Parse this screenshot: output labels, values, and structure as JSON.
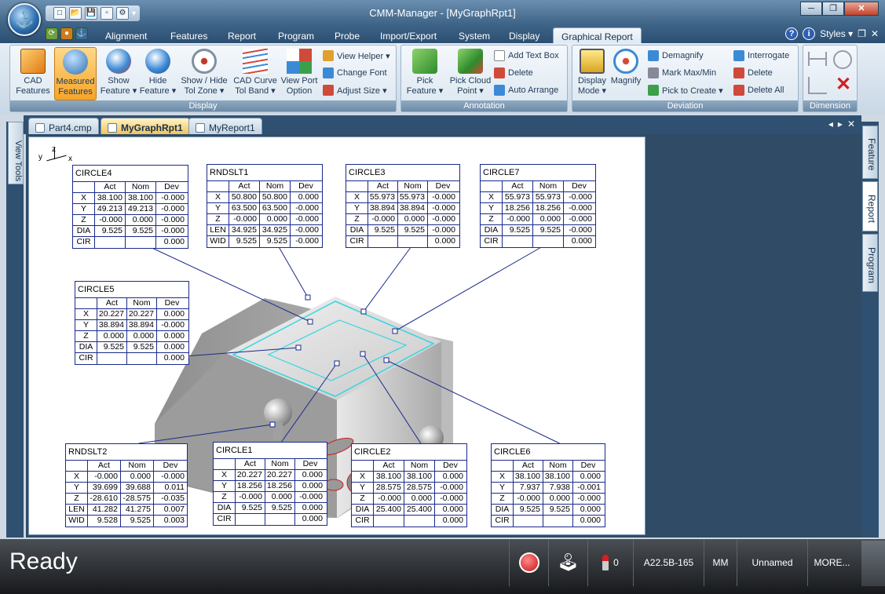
{
  "window": {
    "title": "CMM-Manager - [MyGraphRpt1]",
    "min": "─",
    "max": "❐",
    "close": "✕"
  },
  "quick_access": [
    "□",
    "📂",
    "💾",
    "▫",
    "⚙",
    "▾"
  ],
  "mini_tools": [
    "⟳",
    "●",
    "⚓"
  ],
  "ribbon_tabs": [
    "Alignment",
    "Features",
    "Report",
    "Program",
    "Probe",
    "Import/Export",
    "System",
    "Display",
    "Graphical Report"
  ],
  "active_tab": "Graphical Report",
  "right_options": {
    "help": "?",
    "info": "i",
    "styles": "Styles ▾",
    "restore": "❐",
    "close": "✕"
  },
  "ribbon": {
    "display": {
      "label": "Display",
      "cad": "CAD Features",
      "measured": "Measured Features",
      "show": "Show Feature ▾",
      "hide": "Hide Feature ▾",
      "tolzone": "Show / Hide Tol Zone ▾",
      "curve": "CAD Curve Tol Band ▾",
      "viewport": "View Port Option",
      "viewhelper": "View Helper ▾",
      "changefont": "Change Font",
      "adjustsize": "Adjust Size ▾"
    },
    "annotation": {
      "label": "Annotation",
      "pick": "Pick Feature ▾",
      "cloud": "Pick Cloud Point ▾",
      "addtext": "Add Text Box",
      "delete": "Delete",
      "autoarrange": "Auto Arrange"
    },
    "deviation": {
      "label": "Deviation",
      "mode": "Display Mode ▾",
      "magnify": "Magnify",
      "demagnify": "Demagnify",
      "markmax": "Mark Max/Min",
      "picktocreate": "Pick to Create ▾",
      "interrogate": "Interrogate",
      "delete": "Delete",
      "deleteall": "Delete All"
    },
    "dimension": {
      "label": "Dimension"
    }
  },
  "doc_tabs": [
    "Part4.cmp",
    "MyGraphRpt1",
    "MyReport1"
  ],
  "active_doc": "MyGraphRpt1",
  "doc_controls": {
    "prev": "◂",
    "next": "▸",
    "close": "✕"
  },
  "left_panel": "View Tools",
  "right_panels": [
    "Feature",
    "Report",
    "Program"
  ],
  "axis": {
    "y": "y",
    "z": "z",
    "x": "x"
  },
  "tables": [
    {
      "name": "CIRCLE4",
      "rows": [
        [
          "X",
          "38.100",
          "38.100",
          "-0.000"
        ],
        [
          "Y",
          "49.213",
          "49.213",
          "-0.000"
        ],
        [
          "Z",
          "-0.000",
          "0.000",
          "-0.000"
        ],
        [
          "DIA",
          "9.525",
          "9.525",
          "-0.000"
        ],
        [
          "CIR",
          "",
          "",
          "0.000"
        ]
      ]
    },
    {
      "name": "RNDSLT1",
      "rows": [
        [
          "X",
          "50.800",
          "50.800",
          "0.000"
        ],
        [
          "Y",
          "63.500",
          "63.500",
          "-0.000"
        ],
        [
          "Z",
          "-0.000",
          "0.000",
          "-0.000"
        ],
        [
          "LEN",
          "34.925",
          "34.925",
          "-0.000"
        ],
        [
          "WID",
          "9.525",
          "9.525",
          "-0.000"
        ]
      ]
    },
    {
      "name": "CIRCLE3",
      "rows": [
        [
          "X",
          "55.973",
          "55.973",
          "-0.000"
        ],
        [
          "Y",
          "38.894",
          "38.894",
          "-0.000"
        ],
        [
          "Z",
          "-0.000",
          "0.000",
          "-0.000"
        ],
        [
          "DIA",
          "9.525",
          "9.525",
          "-0.000"
        ],
        [
          "CIR",
          "",
          "",
          "0.000"
        ]
      ]
    },
    {
      "name": "CIRCLE7",
      "rows": [
        [
          "X",
          "55.973",
          "55.973",
          "-0.000"
        ],
        [
          "Y",
          "18.256",
          "18.256",
          "-0.000"
        ],
        [
          "Z",
          "-0.000",
          "0.000",
          "-0.000"
        ],
        [
          "DIA",
          "9.525",
          "9.525",
          "-0.000"
        ],
        [
          "CIR",
          "",
          "",
          "0.000"
        ]
      ]
    },
    {
      "name": "CIRCLE5",
      "rows": [
        [
          "X",
          "20.227",
          "20.227",
          "0.000"
        ],
        [
          "Y",
          "38.894",
          "38.894",
          "-0.000"
        ],
        [
          "Z",
          "0.000",
          "0.000",
          "0.000"
        ],
        [
          "DIA",
          "9.525",
          "9.525",
          "0.000"
        ],
        [
          "CIR",
          "",
          "",
          "0.000"
        ]
      ]
    },
    {
      "name": "RNDSLT2",
      "rows": [
        [
          "X",
          "-0.000",
          "0.000",
          "-0.000"
        ],
        [
          "Y",
          "39.699",
          "39.688",
          "0.011"
        ],
        [
          "Z",
          "-28.610",
          "-28.575",
          "-0.035"
        ],
        [
          "LEN",
          "41.282",
          "41.275",
          "0.007"
        ],
        [
          "WID",
          "9.528",
          "9.525",
          "0.003"
        ]
      ]
    },
    {
      "name": "CIRCLE1",
      "rows": [
        [
          "X",
          "20.227",
          "20.227",
          "0.000"
        ],
        [
          "Y",
          "18.256",
          "18.256",
          "0.000"
        ],
        [
          "Z",
          "-0.000",
          "0.000",
          "-0.000"
        ],
        [
          "DIA",
          "9.525",
          "9.525",
          "0.000"
        ],
        [
          "CIR",
          "",
          "",
          "0.000"
        ]
      ]
    },
    {
      "name": "CIRCLE2",
      "rows": [
        [
          "X",
          "38.100",
          "38.100",
          "0.000"
        ],
        [
          "Y",
          "28.575",
          "28.575",
          "-0.000"
        ],
        [
          "Z",
          "-0.000",
          "0.000",
          "-0.000"
        ],
        [
          "DIA",
          "25.400",
          "25.400",
          "0.000"
        ],
        [
          "CIR",
          "",
          "",
          "0.000"
        ]
      ]
    },
    {
      "name": "CIRCLE6",
      "rows": [
        [
          "X",
          "38.100",
          "38.100",
          "0.000"
        ],
        [
          "Y",
          "7.937",
          "7.938",
          "-0.001"
        ],
        [
          "Z",
          "-0.000",
          "0.000",
          "-0.000"
        ],
        [
          "DIA",
          "9.525",
          "9.525",
          "0.000"
        ],
        [
          "CIR",
          "",
          "",
          "0.000"
        ]
      ]
    }
  ],
  "headers": {
    "act": "Act",
    "nom": "Nom",
    "dev": "Dev"
  },
  "status": {
    "ready": "Ready",
    "probe_count": "0",
    "probe_name": "A22.5B-165",
    "units": "MM",
    "program": "Unnamed",
    "more": "MORE..."
  },
  "colors": {
    "ribbon_active": "#f6a428",
    "table_border": "#1a2a8a",
    "status_bg": "#17191c"
  }
}
